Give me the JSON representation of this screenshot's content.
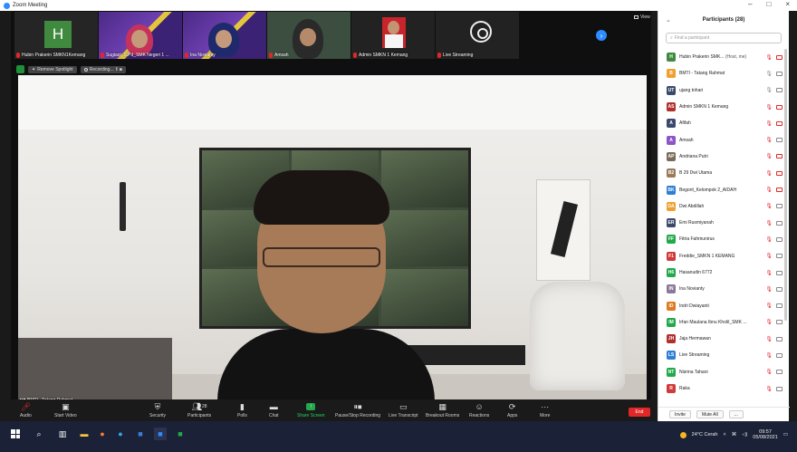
{
  "window": {
    "title": "Zoom Meeting",
    "min": "–",
    "max": "□",
    "close": "×"
  },
  "thumbnails": [
    {
      "name": "Hubin Prakerin SMKN1Kemang",
      "avatar_letter": "H",
      "type": "avatar"
    },
    {
      "name": "Sugiaqi, S.Pd_SMK Negeri 1 ...",
      "type": "poster"
    },
    {
      "name": "Ina Novianty",
      "type": "poster2"
    },
    {
      "name": "Amsah",
      "type": "video"
    },
    {
      "name": "Admin SMKN 1 Kemang",
      "type": "photo"
    },
    {
      "name": "Live Streaming",
      "type": "obs"
    }
  ],
  "view_label": "View",
  "spotlight": {
    "remove": "Remove Spotlight",
    "recording": "Recording..."
  },
  "main_video": {
    "name": "BMTI - Tatang Rahmat"
  },
  "toolbar": {
    "audio": "Audio",
    "start_video": "Start Video",
    "security": "Security",
    "participants": "Participants",
    "participants_count": "28",
    "polls": "Polls",
    "chat": "Chat",
    "share_screen": "Share Screen",
    "pause_recording": "Pause/Stop Recording",
    "live_transcript": "Live Transcript",
    "breakout_rooms": "Breakout Rooms",
    "reactions": "Reactions",
    "apps": "Apps",
    "more": "More",
    "end": "End"
  },
  "panel": {
    "title": "Participants (28)",
    "search_placeholder": "Find a participant",
    "invite": "Invite",
    "mute_all": "Mute All",
    "more": "..."
  },
  "participants": [
    {
      "initials": "H",
      "color": "#3f8a3f",
      "name": "Hubin Prakerin SMK...",
      "sub": " (Host, me)",
      "mic": "off",
      "cam": "off"
    },
    {
      "initials": "B",
      "color": "#f0a030",
      "name": "BMTI - Tatang Rahmat",
      "mic": "on",
      "cam": "on"
    },
    {
      "initials": "UT",
      "color": "#3b4a6b",
      "name": "ujang tohari",
      "mic": "on",
      "cam": "on"
    },
    {
      "initials": "AS",
      "color": "#b03030",
      "name": "Admin SMKN 1 Kemang",
      "mic": "off",
      "cam": "off"
    },
    {
      "initials": "A",
      "color": "#3b4a6b",
      "name": "Afifah",
      "mic": "off",
      "cam": "off"
    },
    {
      "initials": "A",
      "color": "#8e55c8",
      "name": "Amsah",
      "mic": "off",
      "cam": "on"
    },
    {
      "initials": "AP",
      "color": "#7a6a5a",
      "name": "Andriana Putri",
      "mic": "off",
      "cam": "off"
    },
    {
      "initials": "B2",
      "color": "#9a7a5a",
      "name": "B 29 Dwi Utama",
      "mic": "off",
      "cam": "off"
    },
    {
      "initials": "BK",
      "color": "#2d7fd4",
      "name": "Begorit_Kelompok 2_AIDAH",
      "mic": "off",
      "cam": "off"
    },
    {
      "initials": "DA",
      "color": "#f0a030",
      "name": "Dwi Abdillah",
      "mic": "off",
      "cam": "on"
    },
    {
      "initials": "ER",
      "color": "#3b4a6b",
      "name": "Emi Rusmiyanah",
      "mic": "off",
      "cam": "on"
    },
    {
      "initials": "FF",
      "color": "#23a94b",
      "name": "Fitria Fahmunirus",
      "mic": "off",
      "cam": "on"
    },
    {
      "initials": "F1",
      "color": "#d03a3a",
      "name": "Freddie_SMKN 1 KEMANG",
      "mic": "off",
      "cam": "on"
    },
    {
      "initials": "H6",
      "color": "#23a94b",
      "name": "Hasanudin 6772",
      "mic": "off",
      "cam": "on"
    },
    {
      "initials": "IN",
      "color": "#8a7a9a",
      "name": "Ina Novianty",
      "mic": "off",
      "cam": "on"
    },
    {
      "initials": "ID",
      "color": "#e07a20",
      "name": "Indri Dwiayanti",
      "mic": "off",
      "cam": "on"
    },
    {
      "initials": "IM",
      "color": "#23a94b",
      "name": "Irfan Maulana Ibnu Kholil_SMK ...",
      "mic": "off",
      "cam": "on"
    },
    {
      "initials": "JH",
      "color": "#b03030",
      "name": "Jaja Hermawan",
      "mic": "off",
      "cam": "on"
    },
    {
      "initials": "LS",
      "color": "#2d7fd4",
      "name": "Live Streaming",
      "mic": "off",
      "cam": "on"
    },
    {
      "initials": "NT",
      "color": "#23a94b",
      "name": "Nisrina Tahani",
      "mic": "off",
      "cam": "on"
    },
    {
      "initials": "R",
      "color": "#d03a3a",
      "name": "Raka",
      "mic": "off",
      "cam": "on"
    }
  ],
  "taskbar": {
    "weather": "24°C  Cerah",
    "time": "09:57",
    "date": "05/08/2021"
  }
}
